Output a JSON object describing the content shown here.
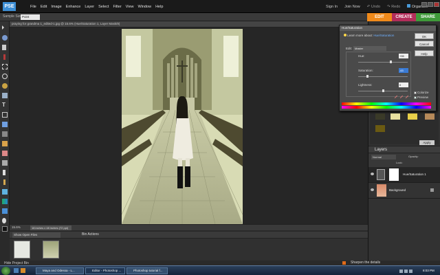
{
  "app": {
    "logo_text": "PSE",
    "menus": [
      "File",
      "Edit",
      "Image",
      "Enhance",
      "Layer",
      "Select",
      "Filter",
      "View",
      "Window",
      "Help"
    ],
    "right_links": {
      "sign_in": "Sign In",
      "join_now": "Join Now"
    },
    "undo": "Undo",
    "redo": "Redo",
    "organizer": "Organizer"
  },
  "mode_tabs": {
    "edit": "EDIT",
    "create": "CREATE",
    "share": "SHARE"
  },
  "options_bar": {
    "label": "Sample Size:",
    "sample_value": "Point Sample"
  },
  "document": {
    "title": "praying for grandma 1_edited-1.jpg @ 15.6% (Hue/Saturation 1, Layer Mask/8)",
    "zoom": "15.6%",
    "doc_size": "18 inches x 48 inches (72 ppi)"
  },
  "bin": {
    "show_open_files": "Show Open Files",
    "bin_actions": "Bin Actions",
    "hide_bin": "Hide Project Bin"
  },
  "dialog": {
    "title": "Hue/Saturation",
    "learn_prefix": "Learn more about:",
    "learn_link": "Hue/Saturation",
    "ok": "OK",
    "cancel": "Cancel",
    "help": "Help",
    "edit_label": "Edit:",
    "edit_value": "Master",
    "hue_label": "Hue:",
    "hue_value": "+55",
    "saturation_label": "Saturation:",
    "saturation_value": "-63",
    "lightness_label": "Lightness:",
    "lightness_value": "0",
    "colorize": "Colorize",
    "preview": "Preview",
    "hue": 55,
    "saturation": -63,
    "lightness": 0
  },
  "panels": {
    "apply": "Apply",
    "layers_title": "Layers",
    "blend_mode": "Normal",
    "opacity_label": "Opacity:",
    "lock_label": "Lock:",
    "layers": [
      {
        "name": "Hue/Saturation 1"
      },
      {
        "name": "Background"
      }
    ]
  },
  "tip": "Sharpen the details",
  "taskbar": {
    "tasks": [
      "Maya and Odessa - L...",
      "Editor - Photoshop ...",
      "Photoshop tutorial f..."
    ],
    "clock": "8:03 PM"
  },
  "colors": {
    "edit_tab": "#f08a1a",
    "create_tab": "#b22d5a",
    "share_tab": "#3f9a3a",
    "link": "#6fb0ff"
  }
}
